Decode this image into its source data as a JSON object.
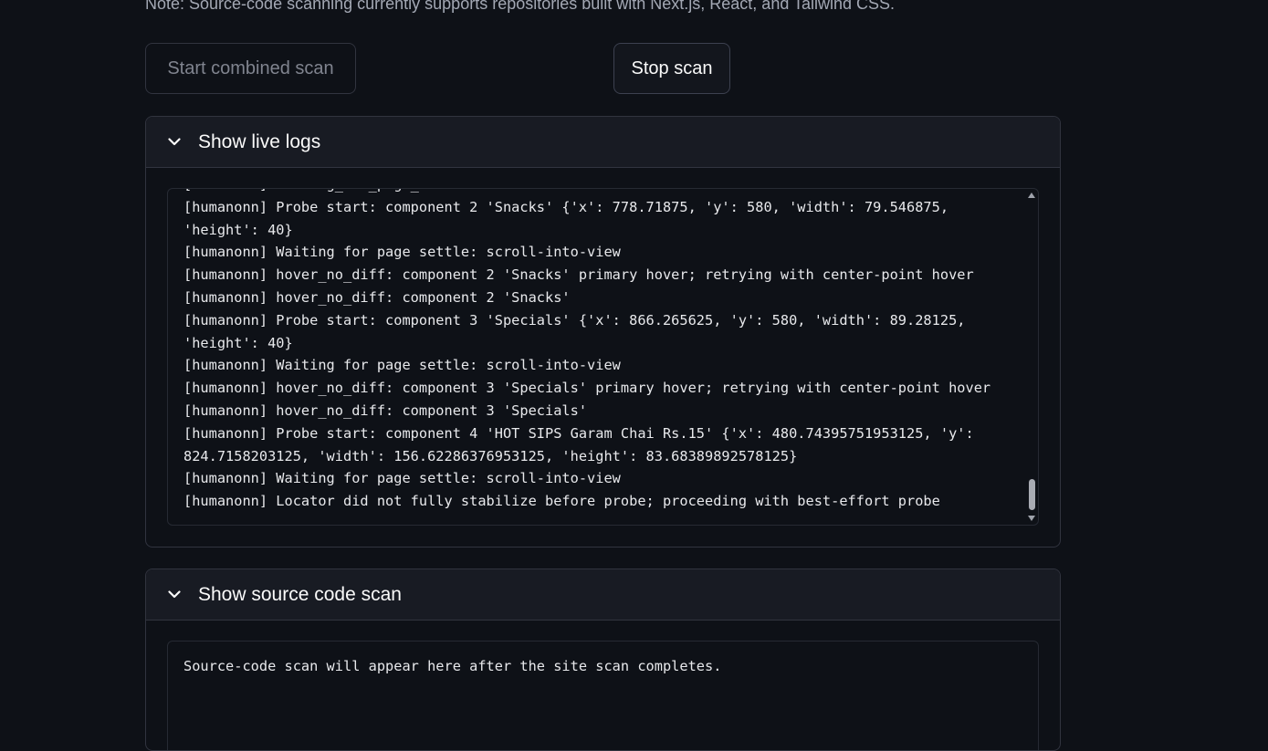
{
  "note": "Note: Source-code scanning currently supports repositories built with Next.js, React, and Tailwind CSS.",
  "buttons": {
    "start_label": "Start combined scan",
    "stop_label": "Stop scan"
  },
  "live_logs": {
    "title": "Show live logs",
    "expanded": true,
    "lines": [
      "[humanonn] Waiting_for_page_settle: scroll-into-view",
      "[humanonn] Probe start: component 2 'Snacks' {'x': 778.71875, 'y': 580, 'width': 79.546875, 'height': 40}",
      "[humanonn] Waiting for page settle: scroll-into-view",
      "[humanonn] hover_no_diff: component 2 'Snacks' primary hover; retrying with center-point hover",
      "[humanonn] hover_no_diff: component 2 'Snacks'",
      "[humanonn] Probe start: component 3 'Specials' {'x': 866.265625, 'y': 580, 'width': 89.28125, 'height': 40}",
      "[humanonn] Waiting for page settle: scroll-into-view",
      "[humanonn] hover_no_diff: component 3 'Specials' primary hover; retrying with center-point hover",
      "[humanonn] hover_no_diff: component 3 'Specials'",
      "[humanonn] Probe start: component 4 'HOT SIPS Garam Chai Rs.15' {'x': 480.74395751953125, 'y': 824.7158203125, 'width': 156.62286376953125, 'height': 83.68389892578125}",
      "[humanonn] Waiting for page settle: scroll-into-view",
      "[humanonn] Locator did not fully stabilize before probe; proceeding with best-effort probe"
    ]
  },
  "source_scan": {
    "title": "Show source code scan",
    "expanded": true,
    "placeholder": "Source-code scan will appear here after the site scan completes."
  },
  "icons": {
    "chevron": "chevron-down-icon"
  },
  "colors": {
    "background": "#0e1117",
    "panel_header": "#181b23",
    "border": "#31343f",
    "text": "#fafafa",
    "muted_text": "#80848f"
  }
}
